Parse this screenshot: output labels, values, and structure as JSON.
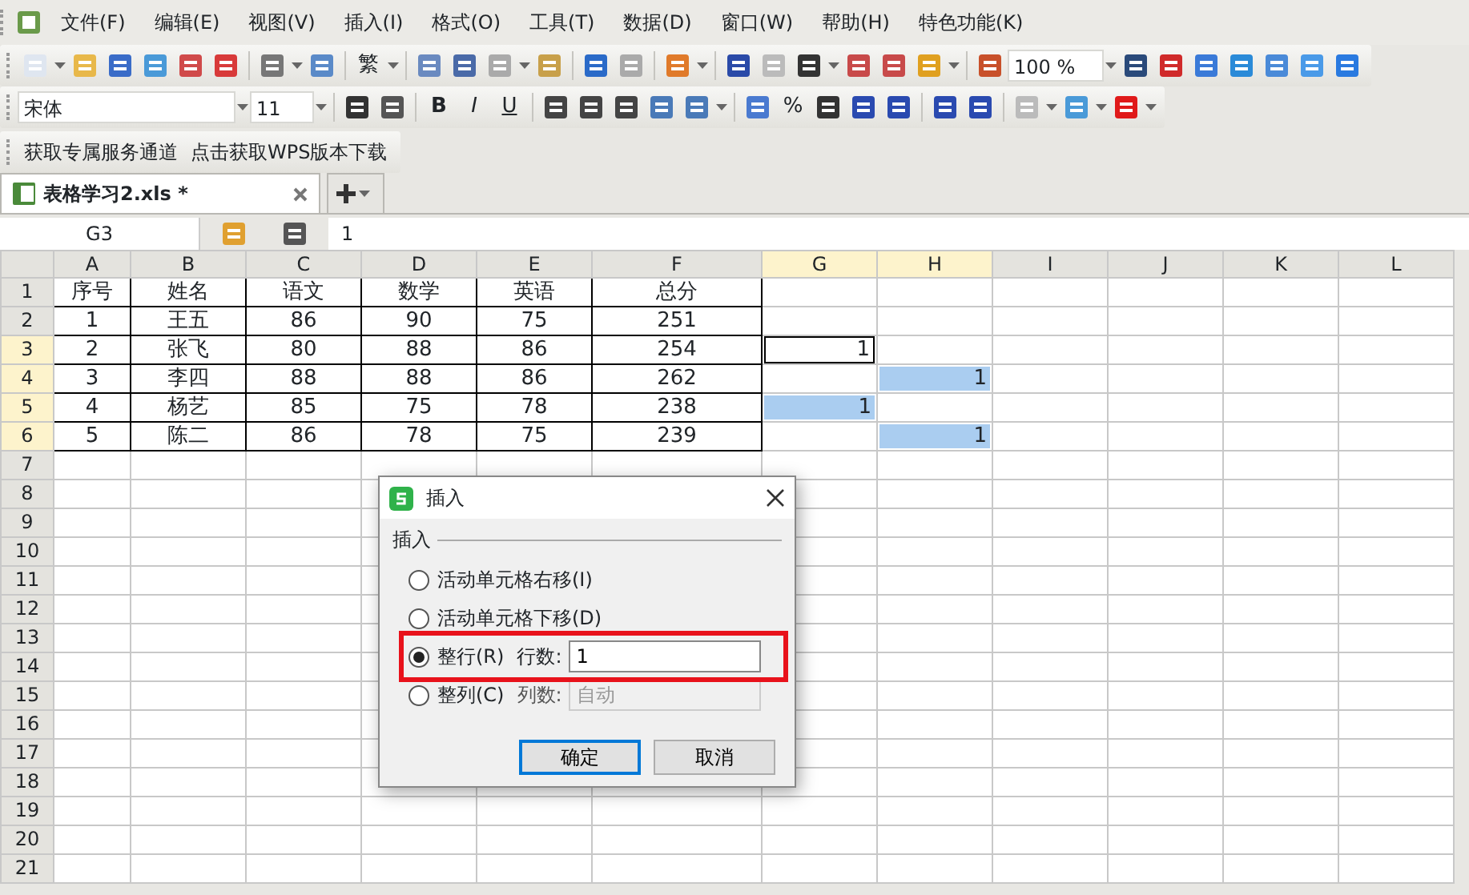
{
  "menu": [
    "文件(F)",
    "编辑(E)",
    "视图(V)",
    "插入(I)",
    "格式(O)",
    "工具(T)",
    "数据(D)",
    "窗口(W)",
    "帮助(H)",
    "特色功能(K)"
  ],
  "toolbar_1": {
    "traditional": "繁",
    "zoom": "100 %"
  },
  "toolbar_2": {
    "font": "宋体",
    "size": "11",
    "bold": "B",
    "italic": "I",
    "underline": "U",
    "percent": "%"
  },
  "links": [
    "获取专属服务通道",
    "点击获取WPS版本下载"
  ],
  "tabs": [
    {
      "label": "表格学习2.xls *",
      "selected": true
    }
  ],
  "name_box": "G3",
  "formula": "1",
  "columns": [
    {
      "label": "A",
      "selected": false
    },
    {
      "label": "B",
      "selected": false
    },
    {
      "label": "C",
      "selected": false
    },
    {
      "label": "D",
      "selected": false
    },
    {
      "label": "E",
      "selected": false
    },
    {
      "label": "F",
      "selected": false
    },
    {
      "label": "G",
      "selected": true
    },
    {
      "label": "H",
      "selected": true
    },
    {
      "label": "I",
      "selected": false
    },
    {
      "label": "J",
      "selected": false
    },
    {
      "label": "K",
      "selected": false
    },
    {
      "label": "L",
      "selected": false
    }
  ],
  "rows": [
    {
      "label": "1",
      "selected": false,
      "cells": [
        "序号",
        "姓名",
        "语文",
        "数学",
        "英语",
        "总分"
      ]
    },
    {
      "label": "2",
      "selected": false,
      "cells": [
        "1",
        "王五",
        "86",
        "90",
        "75",
        "251"
      ]
    },
    {
      "label": "3",
      "selected": true,
      "cells": [
        "2",
        "张飞",
        "80",
        "88",
        "86",
        "254"
      ],
      "cell_g": {
        "text": "1",
        "active": true
      }
    },
    {
      "label": "4",
      "selected": true,
      "cells": [
        "3",
        "李四",
        "88",
        "88",
        "86",
        "262"
      ],
      "cell_h": {
        "text": "1",
        "active": false
      }
    },
    {
      "label": "5",
      "selected": true,
      "cells": [
        "4",
        "杨艺",
        "85",
        "75",
        "78",
        "238"
      ],
      "cell_g": {
        "text": "1",
        "active": false
      }
    },
    {
      "label": "6",
      "selected": true,
      "cells": [
        "5",
        "陈二",
        "86",
        "78",
        "75",
        "239"
      ],
      "cell_h": {
        "text": "1",
        "active": false
      }
    },
    {
      "label": "7",
      "selected": false
    },
    {
      "label": "8",
      "selected": false
    },
    {
      "label": "9",
      "selected": false
    },
    {
      "label": "10",
      "selected": false
    },
    {
      "label": "11",
      "selected": false
    },
    {
      "label": "12",
      "selected": false
    },
    {
      "label": "13",
      "selected": false
    },
    {
      "label": "14",
      "selected": false
    },
    {
      "label": "15",
      "selected": false
    },
    {
      "label": "16",
      "selected": false
    },
    {
      "label": "17",
      "selected": false
    },
    {
      "label": "18",
      "selected": false
    },
    {
      "label": "19",
      "selected": false
    },
    {
      "label": "20",
      "selected": false
    },
    {
      "label": "21",
      "selected": false
    }
  ],
  "dialog": {
    "title": "插入",
    "group": "插入",
    "options": [
      {
        "label": "活动单元格右移(I)",
        "selected": false,
        "highlighted": false
      },
      {
        "label": "活动单元格下移(D)",
        "selected": false,
        "highlighted": false
      },
      {
        "label": "整行(R)",
        "selected": true,
        "highlighted": true,
        "count_label": "行数:",
        "count_value": "1",
        "disabled": false
      },
      {
        "label": "整列(C)",
        "selected": false,
        "highlighted": false,
        "count_label": "列数:",
        "count_value": "自动",
        "disabled": true
      }
    ],
    "buttons": [
      {
        "label": "确定",
        "default": true
      },
      {
        "label": "取消",
        "default": false
      }
    ]
  }
}
